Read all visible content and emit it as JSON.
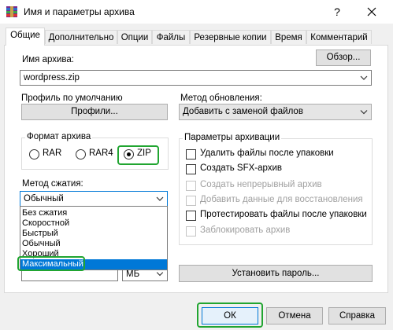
{
  "window": {
    "title": "Имя и параметры архива",
    "help_label": "?",
    "close_label": "✕"
  },
  "tabs": [
    "Общие",
    "Дополнительно",
    "Опции",
    "Файлы",
    "Резервные копии",
    "Время",
    "Комментарий"
  ],
  "archive_name": {
    "label": "Имя архива:",
    "value": "wordpress.zip",
    "browse_label": "Обзор..."
  },
  "profile": {
    "label": "Профиль по умолчанию",
    "button_label": "Профили..."
  },
  "update_method": {
    "label": "Метод обновления:",
    "value": "Добавить с заменой файлов"
  },
  "format": {
    "group_label": "Формат архива",
    "options": [
      "RAR",
      "RAR4",
      "ZIP"
    ],
    "selected": "ZIP"
  },
  "compression": {
    "label": "Метод сжатия:",
    "value": "Обычный",
    "options": [
      "Без сжатия",
      "Скоростной",
      "Быстрый",
      "Обычный",
      "Хороший",
      "Максимальный"
    ],
    "highlighted": "Максимальный"
  },
  "split_unit": "МБ",
  "archive_params": {
    "group_label": "Параметры архивации",
    "options": [
      {
        "label": "Удалить файлы после упаковки",
        "checked": false,
        "enabled": true
      },
      {
        "label": "Создать SFX-архив",
        "checked": false,
        "enabled": true
      },
      {
        "label": "Создать непрерывный архив",
        "checked": false,
        "enabled": false
      },
      {
        "label": "Добавить данные для восстановления",
        "checked": false,
        "enabled": false
      },
      {
        "label": "Протестировать файлы после упаковки",
        "checked": false,
        "enabled": true
      },
      {
        "label": "Заблокировать архив",
        "checked": false,
        "enabled": false
      }
    ]
  },
  "set_password_label": "Установить пароль...",
  "footer": {
    "ok_label": "ОК",
    "cancel_label": "Отмена",
    "help_label": "Справка"
  },
  "colors": {
    "highlight": "#21a531",
    "selection": "#0078d7"
  }
}
